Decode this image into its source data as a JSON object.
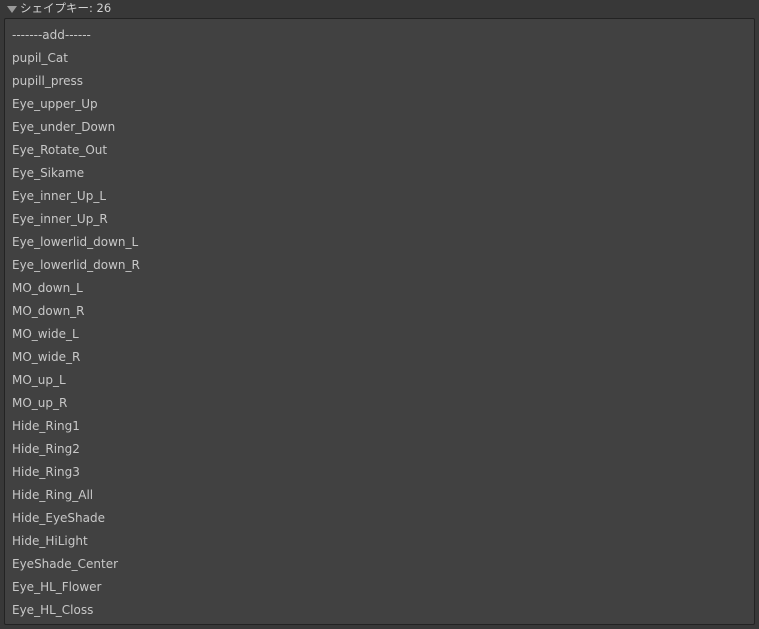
{
  "foldout": {
    "label": "シェイプキー: 26",
    "expanded": true
  },
  "shape_keys": [
    "-------add------",
    "pupil_Cat",
    "pupill_press",
    "Eye_upper_Up",
    "Eye_under_Down",
    "Eye_Rotate_Out",
    "Eye_Sikame",
    "Eye_inner_Up_L",
    "Eye_inner_Up_R",
    "Eye_lowerlid_down_L",
    "Eye_lowerlid_down_R",
    "MO_down_L",
    "MO_down_R",
    "MO_wide_L",
    "MO_wide_R",
    "MO_up_L",
    "MO_up_R",
    "Hide_Ring1",
    "Hide_Ring2",
    "Hide_Ring3",
    "Hide_Ring_All",
    "Hide_EyeShade",
    "Hide_HiLight",
    "EyeShade_Center",
    "Eye_HL_Flower",
    "Eye_HL_Closs"
  ],
  "colors": {
    "background": "#383838",
    "panel": "#414141",
    "text": "#c8c8c8"
  }
}
